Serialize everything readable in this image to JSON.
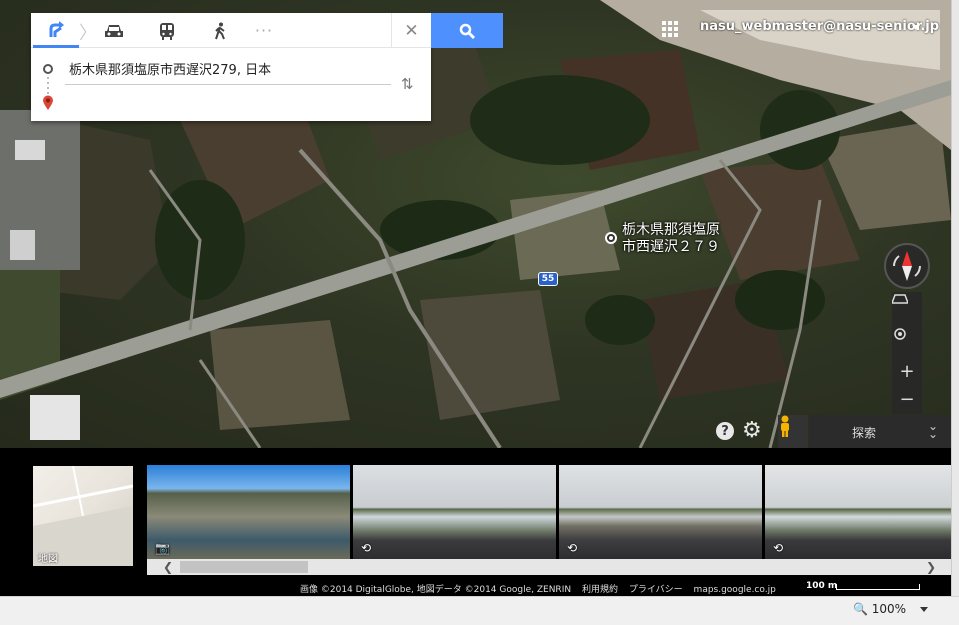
{
  "directions": {
    "origin": "栃木県那須塩原市西遅沢279, 日本",
    "modes": [
      "directions-icon",
      "car-icon",
      "transit-icon",
      "walk-icon",
      "more-icon"
    ],
    "more_label": "···"
  },
  "account": {
    "email": "nasu_webmaster@nasu-senior.jp"
  },
  "map": {
    "place_label_line1": "栃木県那須塩原",
    "place_label_line2": "市西遅沢２７９",
    "route_number": "55"
  },
  "controls": {
    "explore_label": "探索",
    "help_symbol": "?",
    "settings_symbol": "⚙",
    "zoom_in": "+",
    "zoom_out": "−"
  },
  "filmstrip": {
    "map_thumb_label": "地図",
    "thumbs": [
      {
        "icon": "camera-icon"
      },
      {
        "icon": "360-icon"
      },
      {
        "icon": "360-icon"
      },
      {
        "icon": "360-icon"
      }
    ]
  },
  "footer": {
    "imagery": "画像 ©2014 DigitalGlobe, 地図データ ©2014 Google, ZENRIN",
    "terms": "利用規約",
    "privacy": "プライバシー",
    "url": "maps.google.co.jp",
    "scale": "100 m"
  },
  "status": {
    "zoom": "100%"
  },
  "colors": {
    "accent": "#4285f4",
    "search": "#4d90fe",
    "route_shield": "#2a62c9"
  }
}
